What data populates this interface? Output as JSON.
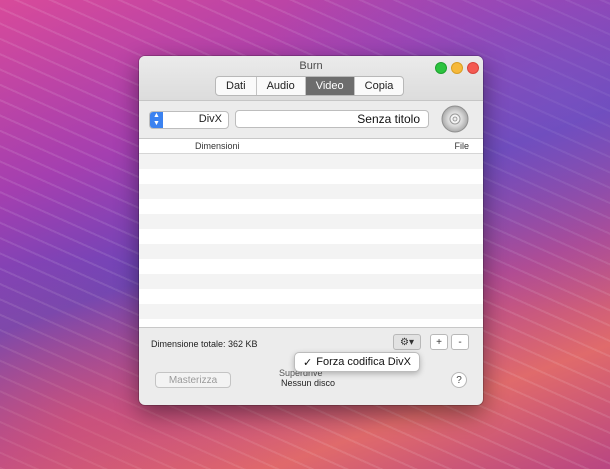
{
  "window": {
    "title": "Burn",
    "tabs": [
      {
        "label": "Dati",
        "active": false
      },
      {
        "label": "Audio",
        "active": false
      },
      {
        "label": "Video",
        "active": true
      },
      {
        "label": "Copia",
        "active": false
      }
    ]
  },
  "disc": {
    "title_value": "Senza titolo",
    "format_selected": "DivX",
    "icon": "disc-icon"
  },
  "table": {
    "columns": [
      "File",
      "Dimensioni"
    ],
    "rows": []
  },
  "toolbar": {
    "minus_label": "-",
    "plus_label": "+",
    "gear_label": "⚙▾",
    "total_label": "Dimensione totale: 362 KB"
  },
  "dropdown": {
    "item_label": "Forza codifica DivX",
    "checked": true,
    "check_glyph": "✓"
  },
  "footer": {
    "help_label": "?",
    "status_line1": "Superdrive",
    "status_line2": "Nessun disco",
    "burn_label": "Masterizza"
  },
  "colors": {
    "active_tab": "#6d6d6d",
    "select_accent": "#3b82f0",
    "close": "#f45a52",
    "minimize": "#f6b93b",
    "zoom": "#2cc33f"
  }
}
